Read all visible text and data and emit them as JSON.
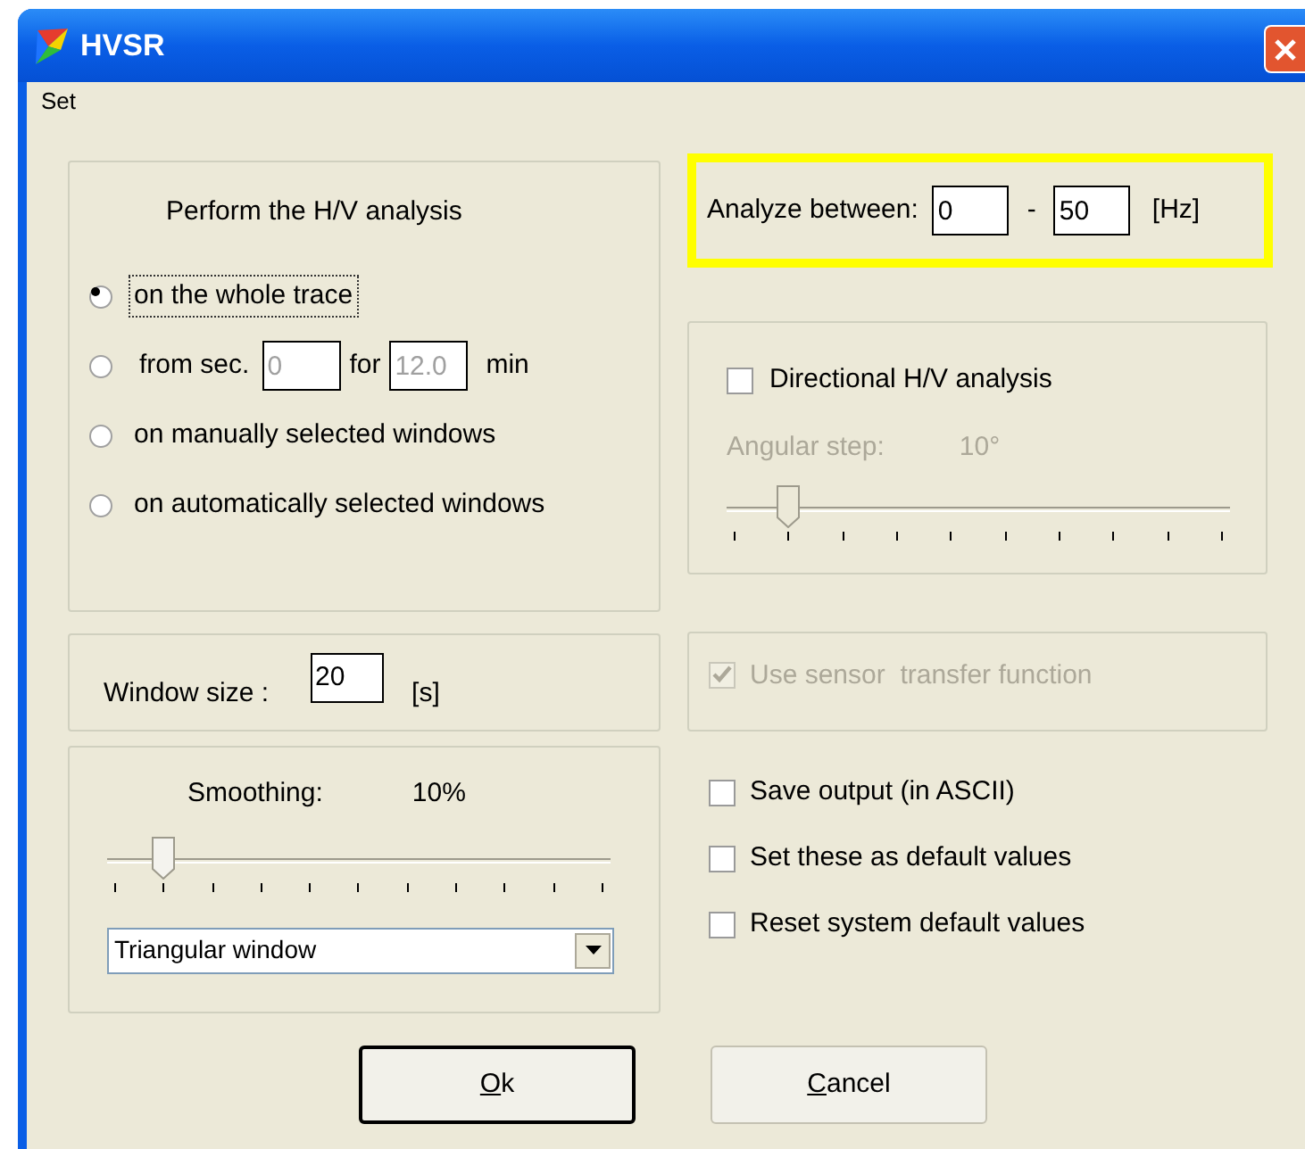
{
  "window": {
    "title": "HVSR"
  },
  "menu": [
    {
      "label": "Set"
    }
  ],
  "analysis": {
    "heading": "Perform the H/V analysis",
    "options": [
      {
        "kind": "plain",
        "label": "on the whole trace",
        "selected": true,
        "focused": true
      },
      {
        "kind": "range",
        "prefix": "from sec.",
        "start": "0",
        "middle": "for",
        "length": "12.0",
        "suffix": "min",
        "selected": false,
        "focused": false
      },
      {
        "kind": "plain",
        "label": "on manually selected windows",
        "selected": false,
        "focused": false
      },
      {
        "kind": "plain",
        "label": "on automatically selected windows",
        "selected": false,
        "focused": false
      }
    ]
  },
  "frequency_range": {
    "label": "Analyze between:",
    "from": "0",
    "separator": "-",
    "to": "50",
    "unit": "[Hz]",
    "highlighted": true
  },
  "directional": {
    "label": "Directional H/V analysis",
    "checked": false,
    "step_label": "Angular step:",
    "step_value": "10°",
    "level": 0.11
  },
  "sensor": {
    "label": "Use sensor  transfer function",
    "checked": true,
    "disabled": true
  },
  "window_size": {
    "label": "Window size :",
    "value": "20",
    "unit": "[s]"
  },
  "smoothing": {
    "label": "Smoothing:",
    "value": "10%",
    "level": 0.1,
    "window_type": "Triangular window"
  },
  "options": [
    {
      "label": "Save output (in ASCII)",
      "checked": false
    },
    {
      "label": "Set these as default values",
      "checked": false
    },
    {
      "label": "Reset system default values",
      "checked": false
    }
  ],
  "buttons": [
    {
      "label": "Ok",
      "default": true
    },
    {
      "label": "Cancel",
      "default": false
    }
  ]
}
